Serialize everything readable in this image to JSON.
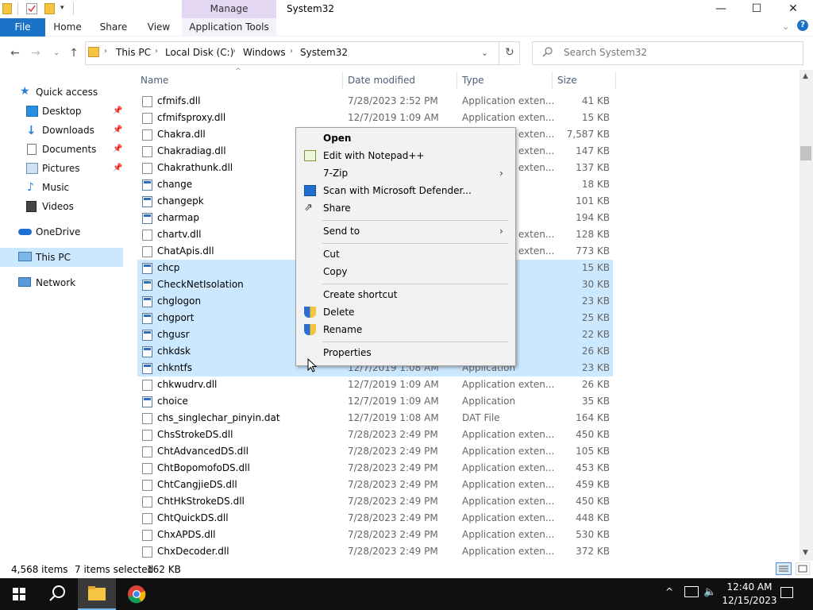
{
  "window": {
    "title": "System32",
    "context_tab_group": "Manage",
    "controls": {
      "minimize": "—",
      "maximize": "☐",
      "close": "✕"
    }
  },
  "ribbon": {
    "tabs": [
      "File",
      "Home",
      "Share",
      "View",
      "Application Tools"
    ]
  },
  "address": {
    "crumbs": [
      "This PC",
      "Local Disk (C:)",
      "Windows",
      "System32"
    ],
    "search_placeholder": "Search System32"
  },
  "nav": {
    "items": [
      {
        "label": "Quick access",
        "icon": "star-icon"
      },
      {
        "label": "Desktop",
        "icon": "desktop-icon",
        "pinned": true
      },
      {
        "label": "Downloads",
        "icon": "download-icon",
        "pinned": true
      },
      {
        "label": "Documents",
        "icon": "documents-icon",
        "pinned": true
      },
      {
        "label": "Pictures",
        "icon": "pictures-icon",
        "pinned": true
      },
      {
        "label": "Music",
        "icon": "music-icon"
      },
      {
        "label": "Videos",
        "icon": "videos-icon"
      },
      {
        "label": "OneDrive",
        "icon": "cloud-icon"
      },
      {
        "label": "This PC",
        "icon": "computer-icon",
        "selected": true
      },
      {
        "label": "Network",
        "icon": "network-icon"
      }
    ]
  },
  "columns": {
    "name": "Name",
    "date": "Date modified",
    "type": "Type",
    "size": "Size"
  },
  "files": [
    {
      "name": "cfmifs.dll",
      "date": "7/28/2023 2:52 PM",
      "type": "Application exten...",
      "size": "41 KB",
      "selected": false,
      "kind": "dll"
    },
    {
      "name": "cfmifsproxy.dll",
      "date": "12/7/2019 1:09 AM",
      "type": "Application exten...",
      "size": "15 KB",
      "selected": false,
      "kind": "dll"
    },
    {
      "name": "Chakra.dll",
      "date": "",
      "type": "Application exten...",
      "size": "7,587 KB",
      "selected": false,
      "kind": "dll"
    },
    {
      "name": "Chakradiag.dll",
      "date": "",
      "type": "Application exten...",
      "size": "147 KB",
      "selected": false,
      "kind": "dll"
    },
    {
      "name": "Chakrathunk.dll",
      "date": "",
      "type": "Application exten...",
      "size": "137 KB",
      "selected": false,
      "kind": "dll"
    },
    {
      "name": "change",
      "date": "",
      "type": "",
      "size": "18 KB",
      "selected": false,
      "kind": "app"
    },
    {
      "name": "changepk",
      "date": "",
      "type": "",
      "size": "101 KB",
      "selected": false,
      "kind": "app"
    },
    {
      "name": "charmap",
      "date": "",
      "type": "",
      "size": "194 KB",
      "selected": false,
      "kind": "app"
    },
    {
      "name": "chartv.dll",
      "date": "",
      "type": "Application exten...",
      "size": "128 KB",
      "selected": false,
      "kind": "dll"
    },
    {
      "name": "ChatApis.dll",
      "date": "",
      "type": "Application exten...",
      "size": "773 KB",
      "selected": false,
      "kind": "dll"
    },
    {
      "name": "chcp",
      "date": "",
      "type": "Applicati...",
      "size": "15 KB",
      "selected": true,
      "kind": "app"
    },
    {
      "name": "CheckNetIsolation",
      "date": "",
      "type": "",
      "size": "30 KB",
      "selected": true,
      "kind": "app"
    },
    {
      "name": "chglogon",
      "date": "",
      "type": "",
      "size": "23 KB",
      "selected": true,
      "kind": "app"
    },
    {
      "name": "chgport",
      "date": "",
      "type": "",
      "size": "25 KB",
      "selected": true,
      "kind": "app"
    },
    {
      "name": "chgusr",
      "date": "",
      "type": "",
      "size": "22 KB",
      "selected": true,
      "kind": "app"
    },
    {
      "name": "chkdsk",
      "date": "",
      "type": "",
      "size": "26 KB",
      "selected": true,
      "kind": "app"
    },
    {
      "name": "chkntfs",
      "date": "12/7/2019 1:08 AM",
      "type": "Application",
      "size": "23 KB",
      "selected": true,
      "kind": "app"
    },
    {
      "name": "chkwudrv.dll",
      "date": "12/7/2019 1:09 AM",
      "type": "Application exten...",
      "size": "26 KB",
      "selected": false,
      "kind": "dll"
    },
    {
      "name": "choice",
      "date": "12/7/2019 1:09 AM",
      "type": "Application",
      "size": "35 KB",
      "selected": false,
      "kind": "app"
    },
    {
      "name": "chs_singlechar_pinyin.dat",
      "date": "12/7/2019 1:08 AM",
      "type": "DAT File",
      "size": "164 KB",
      "selected": false,
      "kind": "dat"
    },
    {
      "name": "ChsStrokeDS.dll",
      "date": "7/28/2023 2:49 PM",
      "type": "Application exten...",
      "size": "450 KB",
      "selected": false,
      "kind": "dll"
    },
    {
      "name": "ChtAdvancedDS.dll",
      "date": "7/28/2023 2:49 PM",
      "type": "Application exten...",
      "size": "105 KB",
      "selected": false,
      "kind": "dll"
    },
    {
      "name": "ChtBopomofoDS.dll",
      "date": "7/28/2023 2:49 PM",
      "type": "Application exten...",
      "size": "453 KB",
      "selected": false,
      "kind": "dll"
    },
    {
      "name": "ChtCangjieDS.dll",
      "date": "7/28/2023 2:49 PM",
      "type": "Application exten...",
      "size": "459 KB",
      "selected": false,
      "kind": "dll"
    },
    {
      "name": "ChtHkStrokeDS.dll",
      "date": "7/28/2023 2:49 PM",
      "type": "Application exten...",
      "size": "450 KB",
      "selected": false,
      "kind": "dll"
    },
    {
      "name": "ChtQuickDS.dll",
      "date": "7/28/2023 2:49 PM",
      "type": "Application exten...",
      "size": "448 KB",
      "selected": false,
      "kind": "dll"
    },
    {
      "name": "ChxAPDS.dll",
      "date": "7/28/2023 2:49 PM",
      "type": "Application exten...",
      "size": "530 KB",
      "selected": false,
      "kind": "dll"
    },
    {
      "name": "ChxDecoder.dll",
      "date": "7/28/2023 2:49 PM",
      "type": "Application exten...",
      "size": "372 KB",
      "selected": false,
      "kind": "dll"
    }
  ],
  "context_menu": {
    "open": "Open",
    "notepad": "Edit with Notepad++",
    "zip": "7-Zip",
    "defender": "Scan with Microsoft Defender...",
    "share": "Share",
    "send_to": "Send to",
    "cut": "Cut",
    "copy": "Copy",
    "create_shortcut": "Create shortcut",
    "delete": "Delete",
    "rename": "Rename",
    "properties": "Properties"
  },
  "status": {
    "item_count": "4,568 items",
    "selection": "7 items selected",
    "selection_size": "162 KB"
  },
  "taskbar": {
    "time": "12:40 AM",
    "date": "12/15/2023"
  },
  "colors": {
    "accent": "#1a73c7",
    "selection": "#cce8ff",
    "manage_band": "#e3d7f1",
    "taskbar": "#101010"
  }
}
